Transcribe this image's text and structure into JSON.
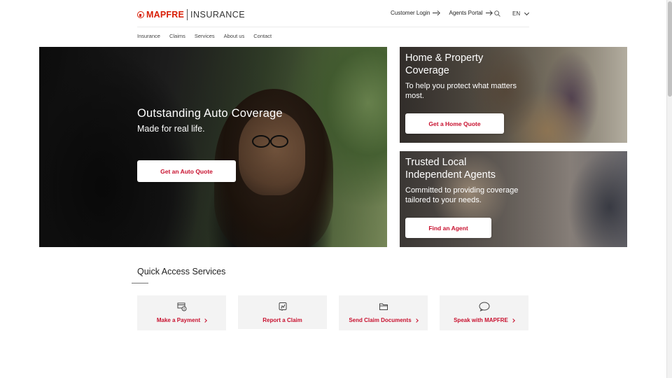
{
  "header": {
    "logo_brand": "MAPFRE",
    "logo_sub": "INSURANCE",
    "customer_login": "Customer Login",
    "agents_portal": "Agents Portal",
    "language": "EN"
  },
  "nav": {
    "items": [
      {
        "label": "Insurance"
      },
      {
        "label": "Claims"
      },
      {
        "label": "Services"
      },
      {
        "label": "About us"
      },
      {
        "label": "Contact"
      }
    ]
  },
  "hero_auto": {
    "title": "Outstanding Auto Coverage",
    "tagline": "Made for real life.",
    "cta": "Get an Auto Quote"
  },
  "hero_home": {
    "title": "Home & Property Coverage",
    "text": "To help you protect what matters most.",
    "cta": "Get a Home Quote"
  },
  "hero_agents": {
    "title": "Trusted Local Independent Agents",
    "text": "Committed to providing coverage tailored to your needs.",
    "cta": "Find an Agent"
  },
  "quick_access": {
    "title": "Quick Access Services",
    "cards": [
      {
        "label": "Make a Payment",
        "icon": "payment-icon"
      },
      {
        "label": "Report a Claim",
        "icon": "report-claim-icon"
      },
      {
        "label": "Send Claim Documents",
        "icon": "folder-icon"
      },
      {
        "label": "Speak with MAPFRE",
        "icon": "chat-bubble-icon"
      }
    ]
  },
  "colors": {
    "brand_red": "#d81e05",
    "cta_red": "#c8102e"
  }
}
